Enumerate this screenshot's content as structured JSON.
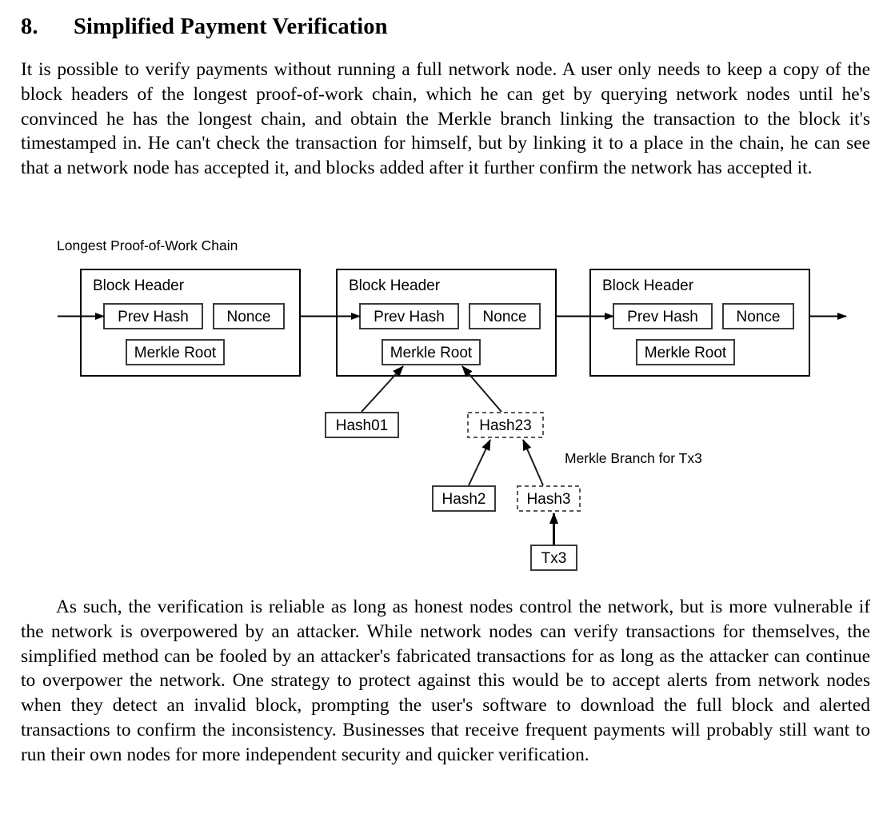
{
  "section": {
    "number": "8.",
    "title": "Simplified Payment Verification"
  },
  "paragraphs": {
    "intro": "It is possible to verify payments without running a full network node.  A user only needs to keep a copy of the block headers of the longest proof-of-work chain, which he can get by querying network nodes until he's convinced he has the longest chain, and obtain the Merkle branch linking the transaction to the block it's timestamped in.  He can't check the transaction for himself, but by linking it to a place in the chain, he can see that a network node has accepted it, and blocks added after it further confirm the network has accepted it.",
    "conclusion": "As such, the verification is reliable as long as honest nodes control the network, but is more vulnerable if the network is overpowered by an attacker.  While network nodes can verify transactions for themselves, the simplified method can be fooled by an attacker's fabricated transactions for as long as the attacker can continue to overpower the network.  One strategy to protect against this would be to accept alerts from network nodes when they detect an invalid block, prompting the user's software to download the full block and alerted transactions to confirm the inconsistency.  Businesses that receive frequent payments will probably still want to run their own nodes for more independent security and quicker verification."
  },
  "diagram": {
    "chain_caption": "Longest Proof-of-Work Chain",
    "branch_caption": "Merkle Branch for Tx3",
    "blocks": [
      {
        "title": "Block Header",
        "prev_hash": "Prev Hash",
        "nonce": "Nonce",
        "merkle_root": "Merkle Root"
      },
      {
        "title": "Block Header",
        "prev_hash": "Prev Hash",
        "nonce": "Nonce",
        "merkle_root": "Merkle Root"
      },
      {
        "title": "Block Header",
        "prev_hash": "Prev Hash",
        "nonce": "Nonce",
        "merkle_root": "Merkle Root"
      }
    ],
    "merkle_nodes": [
      {
        "label": "Hash01",
        "style": "solid"
      },
      {
        "label": "Hash23",
        "style": "dashed"
      },
      {
        "label": "Hash2",
        "style": "solid"
      },
      {
        "label": "Hash3",
        "style": "dashed"
      },
      {
        "label": "Tx3",
        "style": "solid"
      }
    ]
  },
  "colors": {
    "ink": "#000000",
    "paper": "#ffffff",
    "dashed_stroke": "#5a5a5a",
    "box_stroke": "#3a3a3a"
  }
}
